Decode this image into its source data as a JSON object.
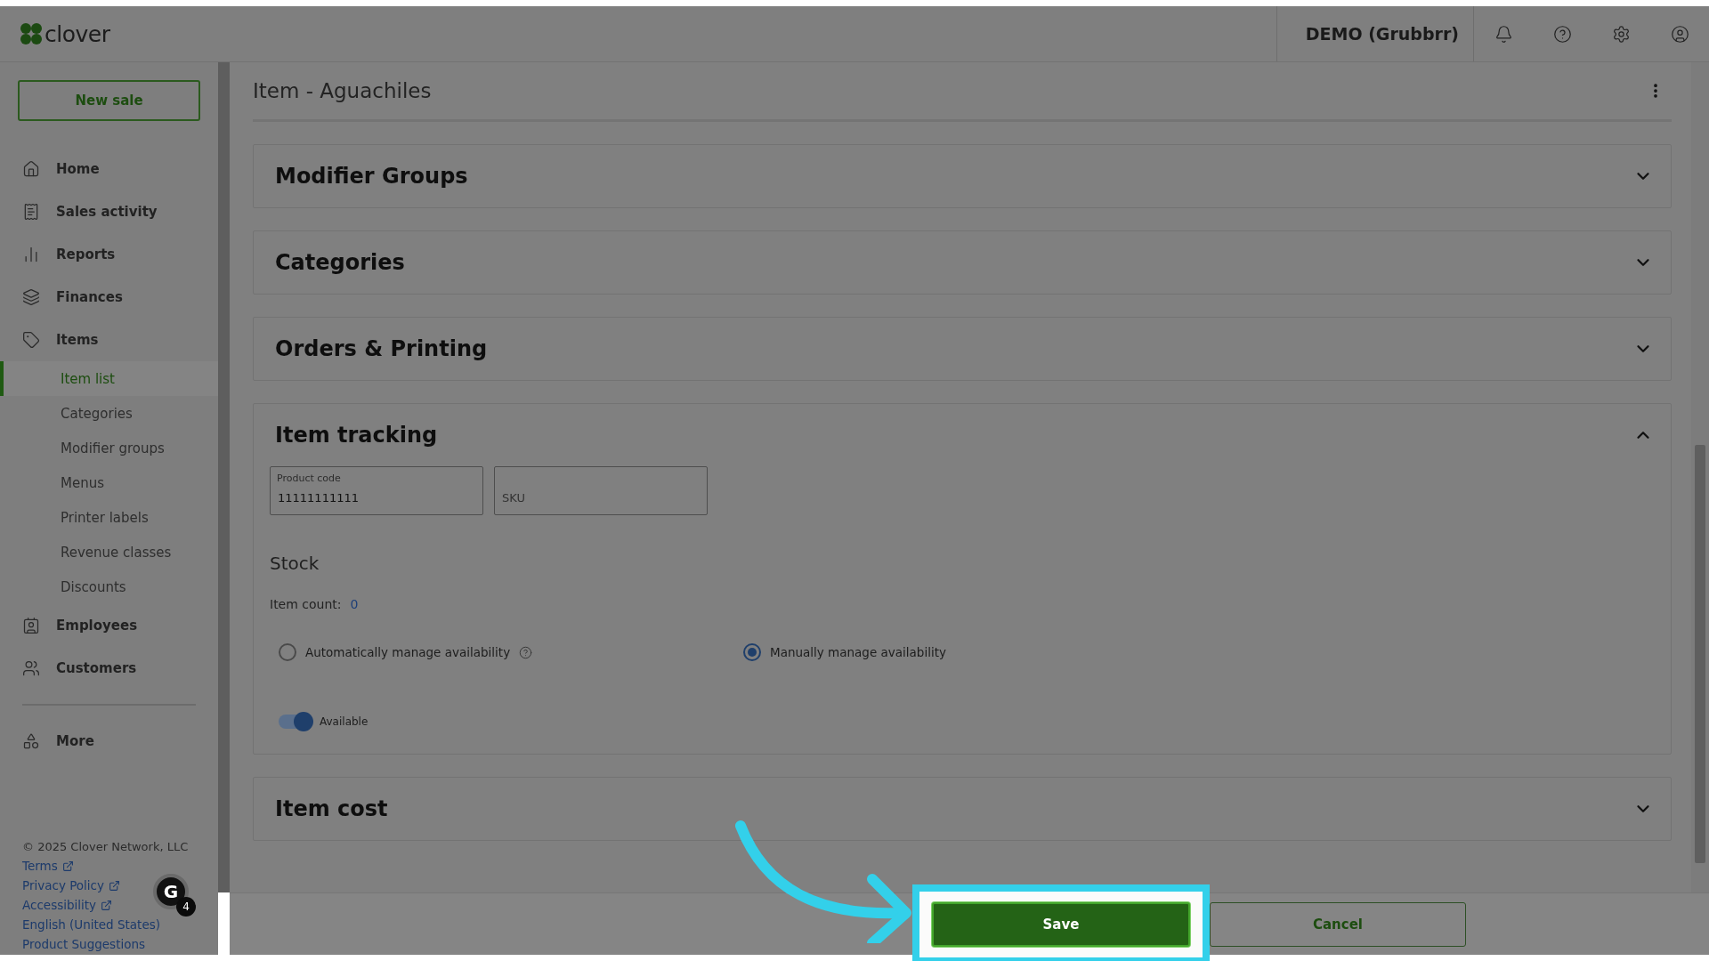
{
  "header": {
    "logo": "clover",
    "merchant": "DEMO (Grubbrr)"
  },
  "sidebar": {
    "new_sale": "New sale",
    "items": [
      {
        "label": "Home"
      },
      {
        "label": "Sales activity"
      },
      {
        "label": "Reports"
      },
      {
        "label": "Finances"
      },
      {
        "label": "Items",
        "children": [
          {
            "label": "Item list",
            "selected": true
          },
          {
            "label": "Categories",
            "selected": false
          },
          {
            "label": "Modifier groups",
            "selected": false
          },
          {
            "label": "Menus",
            "selected": false
          },
          {
            "label": "Printer labels",
            "selected": false
          },
          {
            "label": "Revenue classes",
            "selected": false
          },
          {
            "label": "Discounts",
            "selected": false
          }
        ]
      },
      {
        "label": "Employees"
      },
      {
        "label": "Customers"
      }
    ],
    "more": {
      "label": "More"
    },
    "copyright": "© 2025 Clover Network, LLC",
    "links": [
      {
        "label": "Terms",
        "external": true
      },
      {
        "label": "Privacy Policy",
        "external": true
      },
      {
        "label": "Accessibility",
        "external": true
      },
      {
        "label": "English (United States)",
        "external": false
      },
      {
        "label": "Product Suggestions",
        "external": false
      }
    ],
    "extension_badge": {
      "letter": "G",
      "count": "4"
    }
  },
  "page": {
    "title": "Item - Aguachiles",
    "sections": [
      {
        "title": "Modifier Groups",
        "expanded": false
      },
      {
        "title": "Categories",
        "expanded": false
      },
      {
        "title": "Orders & Printing",
        "expanded": false
      },
      {
        "title": "Item tracking",
        "expanded": true,
        "kind": "tracking"
      },
      {
        "title": "Item cost",
        "expanded": false
      }
    ]
  },
  "tracking": {
    "fields": [
      {
        "label": "Product code",
        "value": "11111111111"
      },
      {
        "placeholder": "SKU"
      }
    ],
    "stock_heading": "Stock",
    "count_label": "Item count:",
    "count_value": "0",
    "options": [
      {
        "label": "Automatically manage availability",
        "selected": false,
        "help": true
      },
      {
        "label": "Manually manage availability",
        "selected": true,
        "help": false
      }
    ],
    "toggle": {
      "label": "Available",
      "on": true
    }
  },
  "footer": {
    "buttons": [
      {
        "label": "Save",
        "kind": "primary",
        "highlighted": true
      },
      {
        "label": "Cancel",
        "kind": "secondary",
        "highlighted": false
      }
    ]
  }
}
